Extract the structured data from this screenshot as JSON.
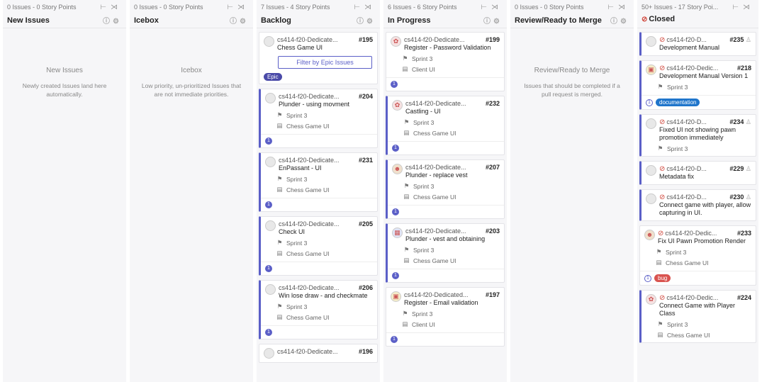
{
  "columns": [
    {
      "meta": "0 Issues - 0 Story Points",
      "title": "New Issues",
      "empty_heading": "New Issues",
      "empty_desc": "Newly created Issues land here automatically."
    },
    {
      "meta": "0 Issues - 0 Story Points",
      "title": "Icebox",
      "empty_heading": "Icebox",
      "empty_desc": "Low priority, un-prioritized Issues that are not immediate priorities."
    },
    {
      "meta": "7 Issues - 4 Story Points",
      "title": "Backlog",
      "cards": [
        {
          "repo": "cs414-f20-Dedicate...",
          "num": "#195",
          "title": "Chess Game UI",
          "filter_button": "Filter by Epic Issues",
          "label": "Epic",
          "label_color": "#4a4aa8"
        },
        {
          "repo": "cs414-f20-Dedicate...",
          "num": "#204",
          "title": "Plunder - using movment",
          "sprint": "Sprint 3",
          "epic": "Chess Game UI",
          "weight": "1"
        },
        {
          "repo": "cs414-f20-Dedicate...",
          "num": "#231",
          "title": "EnPassant - UI",
          "sprint": "Sprint 3",
          "epic": "Chess Game UI",
          "weight": "1"
        },
        {
          "repo": "cs414-f20-Dedicate...",
          "num": "#205",
          "title": "Check UI",
          "sprint": "Sprint 3",
          "epic": "Chess Game UI",
          "weight": "1"
        },
        {
          "repo": "cs414-f20-Dedicate...",
          "num": "#206",
          "title": "Win lose draw - and checkmate",
          "sprint": "Sprint 3",
          "epic": "Chess Game UI",
          "weight": "1"
        },
        {
          "repo": "cs414-f20-Dedicate...",
          "num": "#196"
        }
      ]
    },
    {
      "meta": "6 Issues - 6 Story Points",
      "title": "In Progress",
      "cards": [
        {
          "repo": "cs414-f20-Dedicate...",
          "num": "#199",
          "title": "Register - Password Validation",
          "sprint": "Sprint 3",
          "epic": "Client UI",
          "weight": "1",
          "avatar": "red"
        },
        {
          "repo": "cs414-f20-Dedicate...",
          "num": "#232",
          "title": "Castling - UI",
          "sprint": "Sprint 3",
          "epic": "Chess Game UI",
          "weight": "1",
          "avatar": "red"
        },
        {
          "repo": "cs414-f20-Dedicate...",
          "num": "#207",
          "title": "Plunder - replace vest",
          "sprint": "Sprint 3",
          "epic": "Chess Game UI",
          "weight": "1",
          "avatar": "brown"
        },
        {
          "repo": "cs414-f20-Dedicate...",
          "num": "#203",
          "title": "Plunder - vest and obtaining",
          "sprint": "Sprint 3",
          "epic": "Chess Game UI",
          "weight": "1",
          "avatar": "blue"
        },
        {
          "repo": "cs414-f20-Dedicated...",
          "num": "#197",
          "title": "Register - Email validation",
          "sprint": "Sprint 3",
          "epic": "Client UI",
          "weight": "1",
          "avatar": "yellow"
        }
      ]
    },
    {
      "meta": "0 Issues - 0 Story Points",
      "title": "Review/Ready to Merge",
      "empty_heading": "Review/Ready to Merge",
      "empty_desc": "Issues that should be completed if a pull request is merged."
    },
    {
      "meta": "50+ Issues - 17 Story Poi...",
      "title": "Closed",
      "cards": [
        {
          "repo": "cs414-f20-D...",
          "num": "#235",
          "title": "Development Manual"
        },
        {
          "repo": "cs414-f20-Dedic...",
          "num": "#218",
          "title": "Development Manual Version 1",
          "sprint": "Sprint 3",
          "weight": "1",
          "label": "documentation",
          "label_color": "#1f75cb",
          "avatar": "yellow"
        },
        {
          "repo": "cs414-f20-D...",
          "num": "#234",
          "title": "Fixed UI not showing pawn promotion immediately",
          "sprint": "Sprint 3"
        },
        {
          "repo": "cs414-f20-D...",
          "num": "#229",
          "title": "Metadata fix"
        },
        {
          "repo": "cs414-f20-D...",
          "num": "#230",
          "title": "Connect game with player, allow capturing in UI."
        },
        {
          "repo": "cs414-f20-Dedic...",
          "num": "#233",
          "title": "Fix UI Pawn Promotion Render",
          "sprint": "Sprint 3",
          "epic": "Chess Game UI",
          "weight": "1",
          "label": "bug",
          "label_color": "#d9534f",
          "avatar": "brown"
        },
        {
          "repo": "cs414-f20-Dedic...",
          "num": "#224",
          "title": "Connect Game with Player Class",
          "sprint": "Sprint 3",
          "epic": "Chess Game UI",
          "avatar": "red"
        }
      ]
    }
  ]
}
